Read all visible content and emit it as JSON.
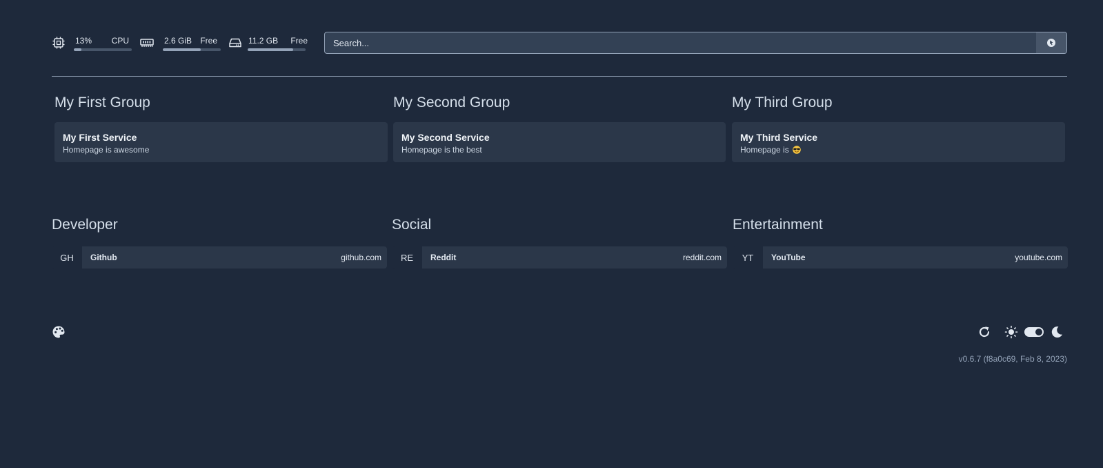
{
  "resources": {
    "cpu": {
      "value": "13%",
      "label": "CPU",
      "usage": 0.13,
      "icon": "cpu-icon"
    },
    "memory": {
      "value": "2.6 GiB",
      "label": "Free",
      "usage": 0.65,
      "icon": "memory-icon"
    },
    "disk": {
      "value": "11.2 GB",
      "label": "Free",
      "usage": 0.78,
      "icon": "disk-icon"
    }
  },
  "search": {
    "placeholder": "Search...",
    "engine_icon": "search-engine-icon"
  },
  "groups": [
    {
      "title": "My First Group",
      "service": {
        "name": "My First Service",
        "description": "Homepage is awesome"
      }
    },
    {
      "title": "My Second Group",
      "service": {
        "name": "My Second Service",
        "description": "Homepage is the best"
      }
    },
    {
      "title": "My Third Group",
      "service": {
        "name": "My Third Service",
        "description": "Homepage is",
        "emoji": "sunglasses-emoji"
      }
    }
  ],
  "bookmarks": [
    {
      "title": "Developer",
      "abbr": "GH",
      "name": "Github",
      "host": "github.com"
    },
    {
      "title": "Social",
      "abbr": "RE",
      "name": "Reddit",
      "host": "reddit.com"
    },
    {
      "title": "Entertainment",
      "abbr": "YT",
      "name": "YouTube",
      "host": "youtube.com"
    }
  ],
  "footer": {
    "version": "v0.6.7 (f8a0c69, Feb 8, 2023)",
    "icons": [
      "palette-icon",
      "refresh-icon",
      "sun-icon",
      "theme-toggle",
      "moon-icon"
    ]
  },
  "colors": {
    "background": "#1e293b",
    "card": "#2b3749",
    "text": "#e2e8f0",
    "muted": "#94a3b8"
  }
}
